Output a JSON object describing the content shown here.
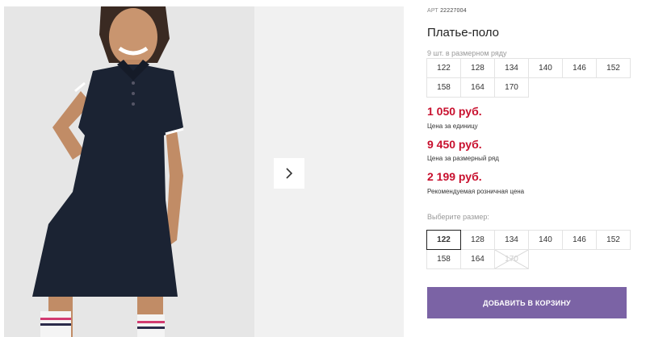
{
  "gallery": {
    "next_icon": "chevron-right-icon"
  },
  "product": {
    "sku_label": "АРТ",
    "sku_value": "22227004",
    "title": "Платье-поло"
  },
  "pack": {
    "label": "9 шт. в размерном ряду",
    "sizes": [
      "122",
      "128",
      "134",
      "140",
      "146",
      "152",
      "158",
      "164",
      "170"
    ]
  },
  "prices": {
    "unit": {
      "value": "1 050 руб.",
      "note": "Цена за единицу"
    },
    "pack": {
      "value": "9 450 руб.",
      "note": "Цена за размерный ряд"
    },
    "retail": {
      "value": "2 199 руб.",
      "note": "Рекомендуемая розничная цена"
    }
  },
  "selector": {
    "label": "Выберите размер:",
    "sizes": [
      "122",
      "128",
      "134",
      "140",
      "146",
      "152",
      "158",
      "164",
      "170"
    ],
    "selected": "122",
    "unavailable": [
      "170"
    ]
  },
  "cart": {
    "label": "ДОБАВИТЬ В КОРЗИНУ"
  },
  "colors": {
    "price": "#c8102e",
    "button": "#7b63a5",
    "dress": "#1b2333"
  }
}
